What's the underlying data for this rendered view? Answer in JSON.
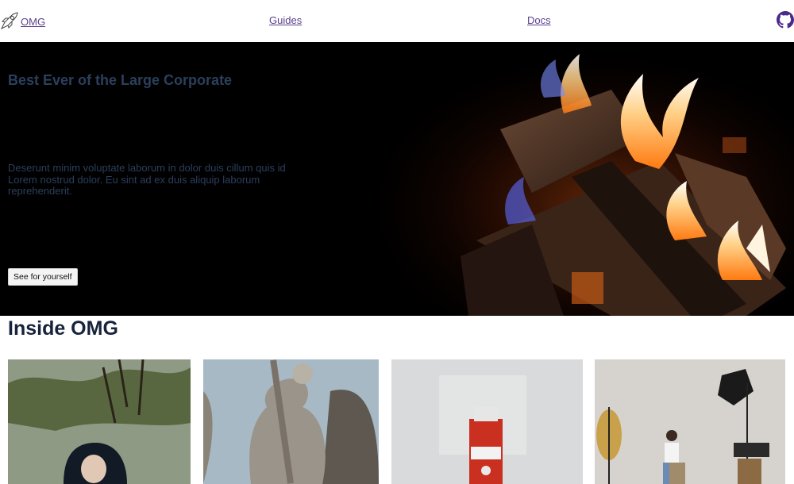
{
  "nav": {
    "brand_label": "OMG",
    "links": [
      {
        "label": "Guides"
      },
      {
        "label": "Docs"
      }
    ],
    "github_icon": "github-icon",
    "brand_icon": "rocket-icon"
  },
  "hero": {
    "title": "Best Ever of the Large Corporate",
    "description": "Deserunt minim voluptate laborum in dolor duis cillum quis id Lorem nostrud dolor. Eu sint ad ex duis aliquip laborum reprehenderit.",
    "cta_label": "See for yourself"
  },
  "section": {
    "title": "Inside OMG"
  },
  "cards": [
    {
      "image": "hooded-person-under-tree"
    },
    {
      "image": "statue-with-sword"
    },
    {
      "image": "grapefruit-oil-bottle"
    },
    {
      "image": "photo-studio-woman-seated"
    }
  ],
  "colors": {
    "link": "#5b3f8c",
    "hero_text": "#2b3f5c",
    "heading": "#17233b",
    "hero_bg": "#000000"
  }
}
